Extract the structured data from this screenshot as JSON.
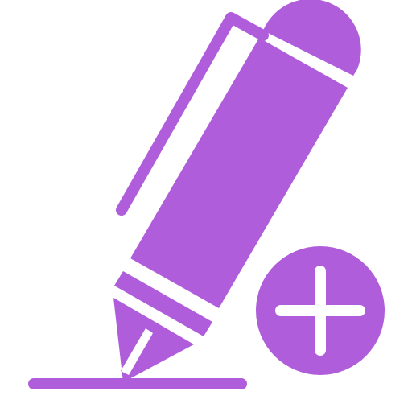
{
  "icon": {
    "name": "add-pen-icon",
    "components": [
      "pen-icon",
      "plus-circle-icon",
      "baseline"
    ],
    "colors": {
      "primary": "#b05ddb",
      "background": "#ffffff"
    }
  }
}
